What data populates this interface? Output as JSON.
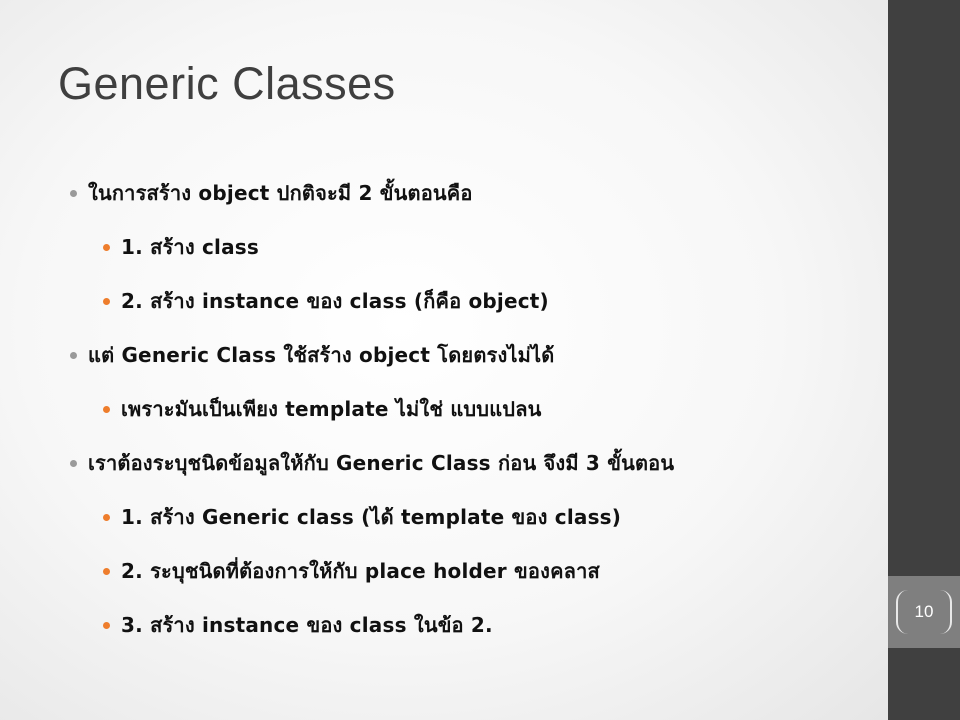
{
  "slide": {
    "title": "Generic Classes",
    "page_number": "10",
    "colors": {
      "title": "#3f3f3f",
      "text": "#111111",
      "bullet_level1": "#9a9a9a",
      "bullet_level2": "#ee7d2c",
      "sidebar": "#404040",
      "page_tab": "#7f7f7f"
    },
    "bullets": [
      {
        "level": 1,
        "text": "ในการสร้าง object ปกติจะมี 2 ขั้นตอนคือ"
      },
      {
        "level": 2,
        "text": "1. สร้าง class"
      },
      {
        "level": 2,
        "text": "2. สร้าง instance ของ class (ก็คือ object)"
      },
      {
        "level": 1,
        "text": "แต่ Generic Class ใช้สร้าง object โดยตรงไม่ได้"
      },
      {
        "level": 2,
        "text": "เพราะมันเป็นเพียง template ไม่ใช่ แบบแปลน"
      },
      {
        "level": 1,
        "text": "เราต้องระบุชนิดข้อมูลให้กับ Generic Class ก่อน จึงมี 3 ขั้นตอน"
      },
      {
        "level": 2,
        "text": "1. สร้าง  Generic class (ได้ template ของ class)"
      },
      {
        "level": 2,
        "text": "2. ระบุชนิดที่ต้องการให้กับ place holder ของคลาส"
      },
      {
        "level": 2,
        "text": "3. สร้าง instance ของ class ในข้อ 2."
      }
    ]
  }
}
